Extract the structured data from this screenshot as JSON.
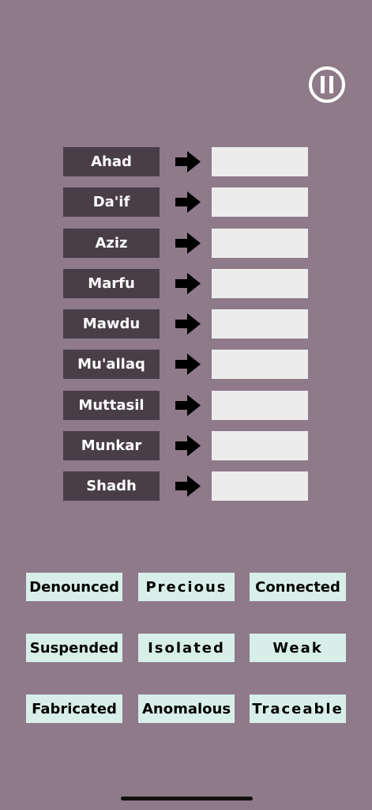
{
  "pause": {
    "icon": "pause-icon"
  },
  "pairs": [
    {
      "term": "Ahad",
      "answer": ""
    },
    {
      "term": "Da'if",
      "answer": ""
    },
    {
      "term": "Aziz",
      "answer": ""
    },
    {
      "term": "Marfu",
      "answer": ""
    },
    {
      "term": "Mawdu",
      "answer": ""
    },
    {
      "term": "Mu'allaq",
      "answer": ""
    },
    {
      "term": "Muttasil",
      "answer": ""
    },
    {
      "term": "Munkar",
      "answer": ""
    },
    {
      "term": "Shadh",
      "answer": ""
    }
  ],
  "choices": [
    "Denounced",
    "Precious",
    "Connected",
    "Suspended",
    "Isolated",
    "Weak",
    "Fabricated",
    "Anomalous",
    "Traceable"
  ],
  "colors": {
    "background": "#8f7a89",
    "term_box": "#4a3e46",
    "answer_slot": "#ececec",
    "choice_tile": "#d8efe9"
  }
}
